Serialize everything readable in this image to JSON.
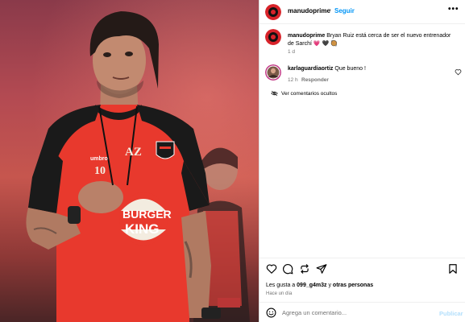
{
  "post": {
    "username": "manudoprime",
    "dot": "•",
    "follow_label": "Seguir",
    "more_label": "•••",
    "image_text": {
      "jersey_initials": "AZ",
      "jersey_number": "10",
      "brand": "umbro",
      "sponsor_line1": "BURGER",
      "sponsor_line2": "KING"
    }
  },
  "caption": {
    "username": "manudoprime",
    "text": "Bryan Ruiz está cerca de ser el nuevo entrenador de Sarchí",
    "emojis": "💗 🖤 🥘",
    "time": "1 d"
  },
  "comment": {
    "username": "karlaguardiaortiz",
    "text": "Que bueno !",
    "time": "12 h",
    "reply_label": "Responder"
  },
  "hidden_comments_label": "Ver comentarios ocultos",
  "actions": {
    "icons": [
      "heart-icon",
      "comment-icon",
      "repost-icon",
      "share-icon",
      "save-icon"
    ]
  },
  "likes": {
    "prefix": "Les gusta a",
    "user": "099_g4m3z",
    "middle": "y",
    "others": "otras personas"
  },
  "post_time": "Hace un día",
  "add_comment": {
    "placeholder": "Agrega un comentario...",
    "publish_label": "Publicar"
  },
  "colors": {
    "accent_blue": "#0095f6",
    "publish_disabled": "#b2dffc",
    "jersey_red": "#e8392d",
    "jersey_black": "#1a1a1a"
  }
}
